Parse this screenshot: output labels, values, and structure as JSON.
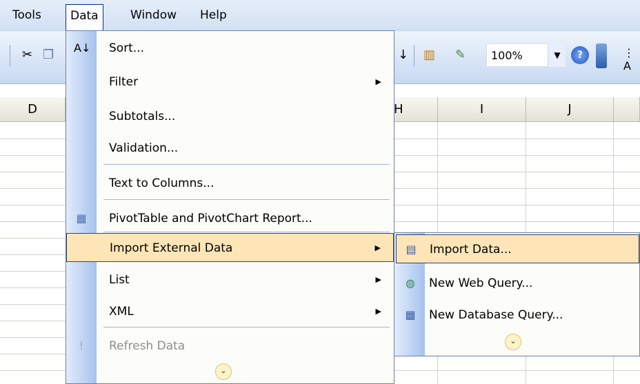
{
  "menubar": {
    "items": [
      {
        "label": "Tools"
      },
      {
        "label": "Data"
      },
      {
        "label": "Window"
      },
      {
        "label": "Help"
      }
    ]
  },
  "toolbar": {
    "zoom": "100%",
    "truncated_label": "A"
  },
  "sheet": {
    "columns": [
      "D",
      "H",
      "I",
      "J"
    ]
  },
  "data_menu": {
    "items": [
      {
        "label": "Sort...",
        "icon": "sort-ascending-icon"
      },
      {
        "label": "Filter",
        "submenu": true
      },
      {
        "label": "Subtotals..."
      },
      {
        "label": "Validation..."
      },
      {
        "label": "Text to Columns..."
      },
      {
        "label": "PivotTable and PivotChart Report...",
        "icon": "pivot-table-icon"
      },
      {
        "label": "Import External Data",
        "submenu": true,
        "highlighted": true
      },
      {
        "label": "List",
        "submenu": true
      },
      {
        "label": "XML",
        "submenu": true
      },
      {
        "label": "Refresh Data",
        "icon": "refresh-icon",
        "disabled": true
      }
    ]
  },
  "import_submenu": {
    "items": [
      {
        "label": "Import Data...",
        "icon": "import-data-icon",
        "highlighted": true
      },
      {
        "label": "New Web Query...",
        "icon": "web-query-icon"
      },
      {
        "label": "New Database Query...",
        "icon": "database-query-icon"
      }
    ]
  },
  "colors": {
    "highlight": "#fde5b7",
    "highlight_border": "#2d4372",
    "menu_bg": "#fcfcf9",
    "gutter": "#a6c2ee"
  }
}
